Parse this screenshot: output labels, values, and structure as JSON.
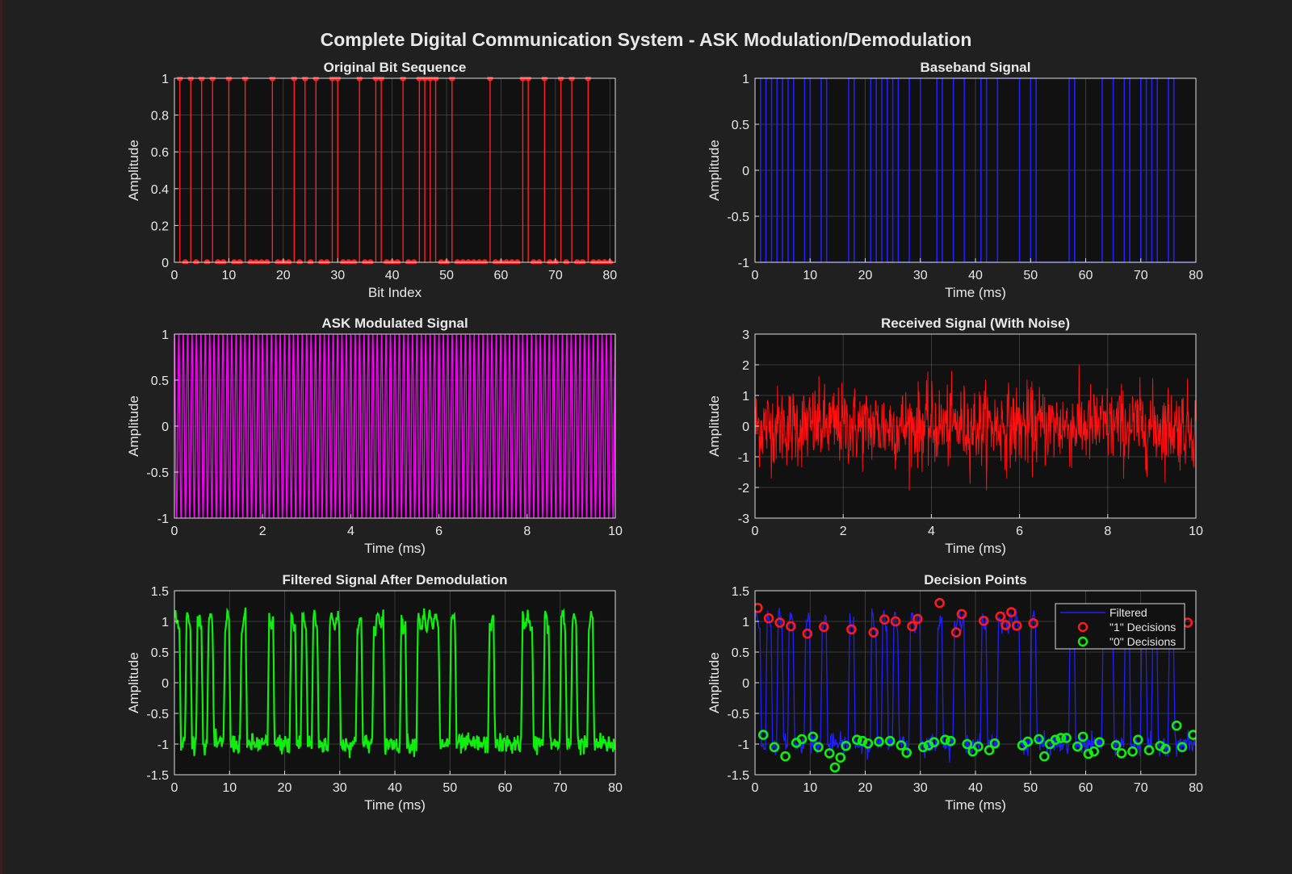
{
  "figure": {
    "title": "Complete Digital Communication System - ASK Modulation/Demodulation",
    "background": "#202020",
    "axes_background": "#111111",
    "text_color": "#e8e8e8",
    "grid_color": "#555555"
  },
  "chart_data": [
    {
      "id": "bits",
      "type": "stem",
      "title": "Original Bit Sequence",
      "xlabel": "Bit Index",
      "ylabel": "Amplitude",
      "xlim": [
        0,
        81
      ],
      "ylim": [
        0,
        1
      ],
      "xticks": [
        0,
        10,
        20,
        30,
        40,
        50,
        60,
        70,
        80
      ],
      "yticks": [
        0,
        0.2,
        0.4,
        0.6,
        0.8,
        1
      ],
      "color": "#ff2020",
      "grid": true,
      "series": [
        {
          "x": [
            1,
            2,
            3,
            4,
            5,
            6,
            7,
            8,
            9,
            10,
            11,
            12,
            13,
            14,
            15,
            16,
            17,
            18,
            19,
            20,
            21,
            22,
            23,
            24,
            25,
            26,
            27,
            28,
            29,
            30,
            31,
            32,
            33,
            34,
            35,
            36,
            37,
            38,
            39,
            40,
            41,
            42,
            43,
            44,
            45,
            46,
            47,
            48,
            49,
            50,
            51,
            52,
            53,
            54,
            55,
            56,
            57,
            58,
            59,
            60,
            61,
            62,
            63,
            64,
            65,
            66,
            67,
            68,
            69,
            70,
            71,
            72,
            73,
            74,
            75,
            76,
            77,
            78,
            79,
            80
          ],
          "y": [
            1,
            0,
            1,
            0,
            1,
            0,
            1,
            0,
            0,
            1,
            0,
            0,
            1,
            0,
            0,
            0,
            0,
            1,
            0,
            0,
            0,
            1,
            0,
            1,
            0,
            1,
            0,
            0,
            1,
            1,
            0,
            0,
            0,
            1,
            0,
            0,
            1,
            1,
            0,
            0,
            0,
            1,
            0,
            0,
            1,
            1,
            1,
            1,
            0,
            0,
            1,
            0,
            0,
            0,
            0,
            0,
            0,
            1,
            0,
            0,
            0,
            0,
            0,
            1,
            1,
            0,
            0,
            1,
            0,
            0,
            1,
            0,
            1,
            0,
            0,
            1,
            0,
            0,
            0,
            0
          ]
        }
      ]
    },
    {
      "id": "baseband",
      "type": "line",
      "title": "Baseband Signal",
      "xlabel": "Time (ms)",
      "ylabel": "Amplitude",
      "xlim": [
        0,
        80
      ],
      "ylim": [
        -1,
        1
      ],
      "xticks": [
        0,
        10,
        20,
        30,
        40,
        50,
        60,
        70,
        80
      ],
      "yticks": [
        -1,
        -0.5,
        0,
        0.5,
        1
      ],
      "color": "#2020ff",
      "grid": true,
      "series": [
        {
          "name": "",
          "bit_values": [
            1,
            0,
            1,
            0,
            1,
            0,
            1,
            0,
            0,
            1,
            0,
            0,
            1,
            0,
            0,
            0,
            0,
            1,
            0,
            0,
            0,
            1,
            0,
            1,
            0,
            1,
            0,
            0,
            1,
            1,
            0,
            0,
            0,
            1,
            0,
            0,
            1,
            1,
            0,
            0,
            0,
            1,
            0,
            0,
            1,
            1,
            1,
            1,
            0,
            0,
            1,
            0,
            0,
            0,
            0,
            0,
            0,
            1,
            0,
            0,
            0,
            0,
            0,
            1,
            1,
            0,
            0,
            1,
            0,
            0,
            1,
            0,
            1,
            0,
            0,
            1,
            0,
            0,
            0,
            0
          ],
          "bit_duration_ms": 1
        }
      ]
    },
    {
      "id": "ask",
      "type": "line",
      "title": "ASK Modulated Signal",
      "xlabel": "Time (ms)",
      "ylabel": "Amplitude",
      "xlim": [
        0,
        10
      ],
      "ylim": [
        -1,
        1
      ],
      "xticks": [
        0,
        2,
        4,
        6,
        8,
        10
      ],
      "yticks": [
        -1,
        -0.5,
        0,
        0.5,
        1
      ],
      "color": "#ff00ff",
      "grid": true,
      "series": [
        {
          "name": "",
          "carrier_cycles_per_ms": 10,
          "amplitude": 1
        }
      ]
    },
    {
      "id": "received",
      "type": "line",
      "title": "Received Signal (With Noise)",
      "xlabel": "Time (ms)",
      "ylabel": "Amplitude",
      "xlim": [
        0,
        10
      ],
      "ylim": [
        -3,
        3
      ],
      "xticks": [
        0,
        2,
        4,
        6,
        8,
        10
      ],
      "yticks": [
        -3,
        -2,
        -1,
        0,
        1,
        2,
        3
      ],
      "color": "#ff1010",
      "grid": true,
      "series": [
        {
          "name": "",
          "approx_range": [
            -2.1,
            2.0
          ],
          "samples": 1000
        }
      ]
    },
    {
      "id": "filtered",
      "type": "line",
      "title": "Filtered Signal After Demodulation",
      "xlabel": "Time (ms)",
      "ylabel": "Amplitude",
      "xlim": [
        0,
        80
      ],
      "ylim": [
        -1.5,
        1.5
      ],
      "xticks": [
        0,
        10,
        20,
        30,
        40,
        50,
        60,
        70,
        80
      ],
      "yticks": [
        -1.5,
        -1,
        -0.5,
        0,
        0.5,
        1,
        1.5
      ],
      "color": "#10ee10",
      "grid": true,
      "series": [
        {
          "name": "",
          "bit_values": [
            1,
            0,
            1,
            0,
            1,
            0,
            1,
            0,
            0,
            1,
            0,
            0,
            1,
            0,
            0,
            0,
            0,
            1,
            0,
            0,
            0,
            1,
            0,
            1,
            0,
            1,
            0,
            0,
            1,
            1,
            0,
            0,
            0,
            1,
            0,
            0,
            1,
            1,
            0,
            0,
            0,
            1,
            0,
            0,
            1,
            1,
            1,
            1,
            0,
            0,
            1,
            0,
            0,
            0,
            0,
            0,
            0,
            1,
            0,
            0,
            0,
            0,
            0,
            1,
            1,
            0,
            0,
            1,
            0,
            0,
            1,
            0,
            1,
            0,
            0,
            1,
            0,
            0,
            0,
            0
          ],
          "high_level": 1,
          "low_level": -1
        }
      ]
    },
    {
      "id": "decisions",
      "type": "scatter",
      "title": "Decision Points",
      "xlabel": "Time (ms)",
      "ylabel": "Amplitude",
      "xlim": [
        0,
        80
      ],
      "ylim": [
        -1.5,
        1.5
      ],
      "xticks": [
        0,
        10,
        20,
        30,
        40,
        50,
        60,
        70,
        80
      ],
      "yticks": [
        -1.5,
        -1,
        -0.5,
        0,
        0.5,
        1,
        1.5
      ],
      "grid": true,
      "legend_position": "top-right",
      "series": [
        {
          "name": "Filtered",
          "type": "line",
          "color": "#2020ff"
        },
        {
          "name": "\"1\" Decisions",
          "type": "scatter",
          "color": "#ff1a1a",
          "x": [
            0.5,
            2.5,
            4.5,
            6.5,
            9.5,
            12.5,
            17.5,
            21.5,
            23.5,
            25.5,
            28.5,
            29.5,
            33.5,
            36.5,
            37.5,
            41.5,
            44.5,
            45.5,
            46.5,
            47.5,
            50.5,
            57.5,
            63.5,
            64.5,
            67.5,
            70.5,
            72.5,
            75.5,
            78.5
          ],
          "y": [
            1.22,
            1.05,
            0.98,
            0.92,
            0.8,
            0.91,
            0.87,
            0.82,
            1.03,
            1.0,
            0.92,
            1.04,
            1.3,
            0.82,
            1.12,
            1.01,
            1.08,
            0.94,
            1.15,
            0.93,
            0.97,
            1.0,
            1.03,
            0.99,
            0.95,
            0.97,
            1.02,
            0.98,
            0.98
          ]
        },
        {
          "name": "\"0\" Decisions",
          "type": "scatter",
          "color": "#10ee10",
          "x": [
            1.5,
            3.5,
            5.5,
            7.5,
            8.5,
            10.5,
            11.5,
            13.5,
            14.5,
            15.5,
            16.5,
            18.5,
            19.5,
            20.5,
            22.5,
            24.5,
            26.5,
            27.5,
            30.5,
            31.5,
            32.5,
            34.5,
            35.5,
            38.5,
            39.5,
            40.5,
            42.5,
            43.5,
            48.5,
            49.5,
            51.5,
            52.5,
            53.5,
            54.5,
            55.5,
            56.5,
            58.5,
            59.5,
            60.5,
            61.5,
            62.5,
            65.5,
            66.5,
            68.5,
            69.5,
            71.5,
            73.5,
            74.5,
            76.5,
            77.5,
            79.5
          ],
          "y": [
            -0.85,
            -1.05,
            -1.2,
            -0.98,
            -0.92,
            -0.88,
            -1.05,
            -1.15,
            -1.38,
            -1.22,
            -1.03,
            -0.93,
            -0.95,
            -0.99,
            -0.96,
            -0.95,
            -1.02,
            -1.14,
            -1.05,
            -1.02,
            -0.97,
            -0.93,
            -0.95,
            -1.0,
            -1.12,
            -1.04,
            -1.1,
            -0.99,
            -1.02,
            -0.96,
            -0.92,
            -1.2,
            -1.0,
            -0.93,
            -0.9,
            -0.9,
            -1.04,
            -0.88,
            -1.16,
            -1.12,
            -0.97,
            -1.02,
            -1.15,
            -1.12,
            -0.93,
            -1.1,
            -1.03,
            -1.08,
            -0.7,
            -1.05,
            -0.85
          ]
        }
      ]
    }
  ]
}
